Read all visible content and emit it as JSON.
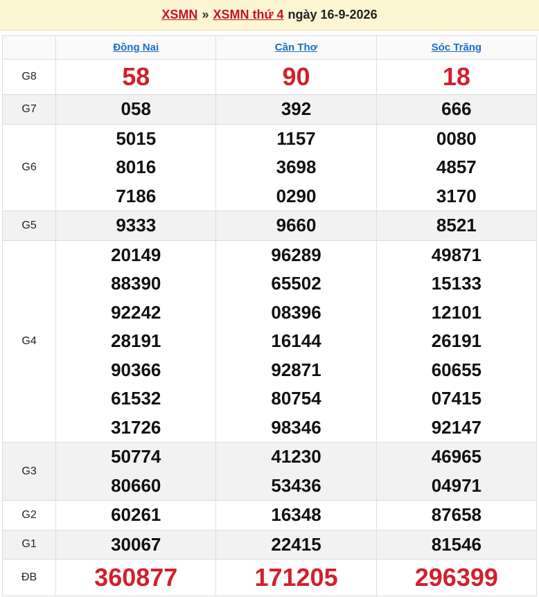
{
  "header": {
    "link1": "XSMN",
    "separator": "»",
    "link2": "XSMN thứ 4",
    "date_text": "ngày 16-9-2026"
  },
  "provinces": [
    "Đồng Nai",
    "Cần Thơ",
    "Sóc Trăng"
  ],
  "prizes": {
    "g8": {
      "label": "G8",
      "values": [
        "58",
        "90",
        "18"
      ]
    },
    "g7": {
      "label": "G7",
      "values": [
        "058",
        "392",
        "666"
      ]
    },
    "g6": {
      "label": "G6",
      "values": [
        [
          "5015",
          "8016",
          "7186"
        ],
        [
          "1157",
          "3698",
          "0290"
        ],
        [
          "0080",
          "4857",
          "3170"
        ]
      ]
    },
    "g5": {
      "label": "G5",
      "values": [
        "9333",
        "9660",
        "8521"
      ]
    },
    "g4": {
      "label": "G4",
      "values": [
        [
          "20149",
          "88390",
          "92242",
          "28191",
          "90366",
          "61532",
          "31726"
        ],
        [
          "96289",
          "65502",
          "08396",
          "16144",
          "92871",
          "80754",
          "98346"
        ],
        [
          "49871",
          "15133",
          "12101",
          "26191",
          "60655",
          "07415",
          "92147"
        ]
      ]
    },
    "g3": {
      "label": "G3",
      "values": [
        [
          "50774",
          "80660"
        ],
        [
          "41230",
          "53436"
        ],
        [
          "46965",
          "04971"
        ]
      ]
    },
    "g2": {
      "label": "G2",
      "values": [
        "60261",
        "16348",
        "87658"
      ]
    },
    "g1": {
      "label": "G1",
      "values": [
        "30067",
        "22415",
        "81546"
      ]
    },
    "db": {
      "label": "ĐB",
      "values": [
        "360877",
        "171205",
        "296399"
      ]
    }
  }
}
